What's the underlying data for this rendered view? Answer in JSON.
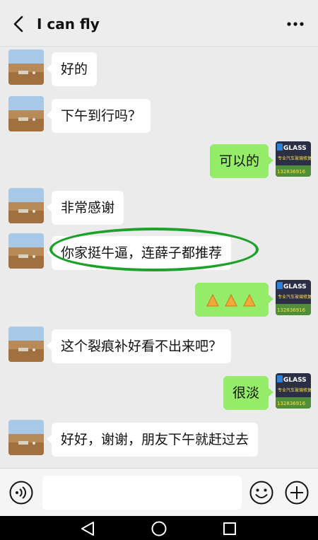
{
  "header": {
    "title": "I can fly"
  },
  "messages": [
    {
      "side": "in",
      "text": "好的"
    },
    {
      "side": "in",
      "text": "下午到行吗？"
    },
    {
      "side": "out",
      "text": "可以的"
    },
    {
      "side": "in",
      "text": "非常感谢"
    },
    {
      "side": "in",
      "text": "你家挺牛逼，连薛子都推荐",
      "highlighted": true
    },
    {
      "side": "out",
      "text": "🙏🙏🙏"
    },
    {
      "side": "in",
      "text": "这个裂痕补好看不出来吧？"
    },
    {
      "side": "out",
      "text": "很淡"
    },
    {
      "side": "in",
      "text": "好好，谢谢，朋友下午就赶过去"
    }
  ],
  "my_avatar": {
    "brand": "GLASS",
    "caption": "专业汽车玻璃修复",
    "phone": "132836916"
  },
  "input": {
    "value": "",
    "placeholder": ""
  },
  "colors": {
    "outgoing_bubble": "#95ec69",
    "incoming_bubble": "#ffffff",
    "highlight_ring": "#1da12b",
    "chat_background": "#ebebeb"
  },
  "icons": {
    "back": "chevron-left-icon",
    "more": "more-dots-icon",
    "voice": "voice-icon",
    "emoji": "emoji-icon",
    "plus": "plus-icon",
    "nav_back": "triangle-back-icon",
    "nav_home": "circle-home-icon",
    "nav_recent": "square-recent-icon"
  }
}
